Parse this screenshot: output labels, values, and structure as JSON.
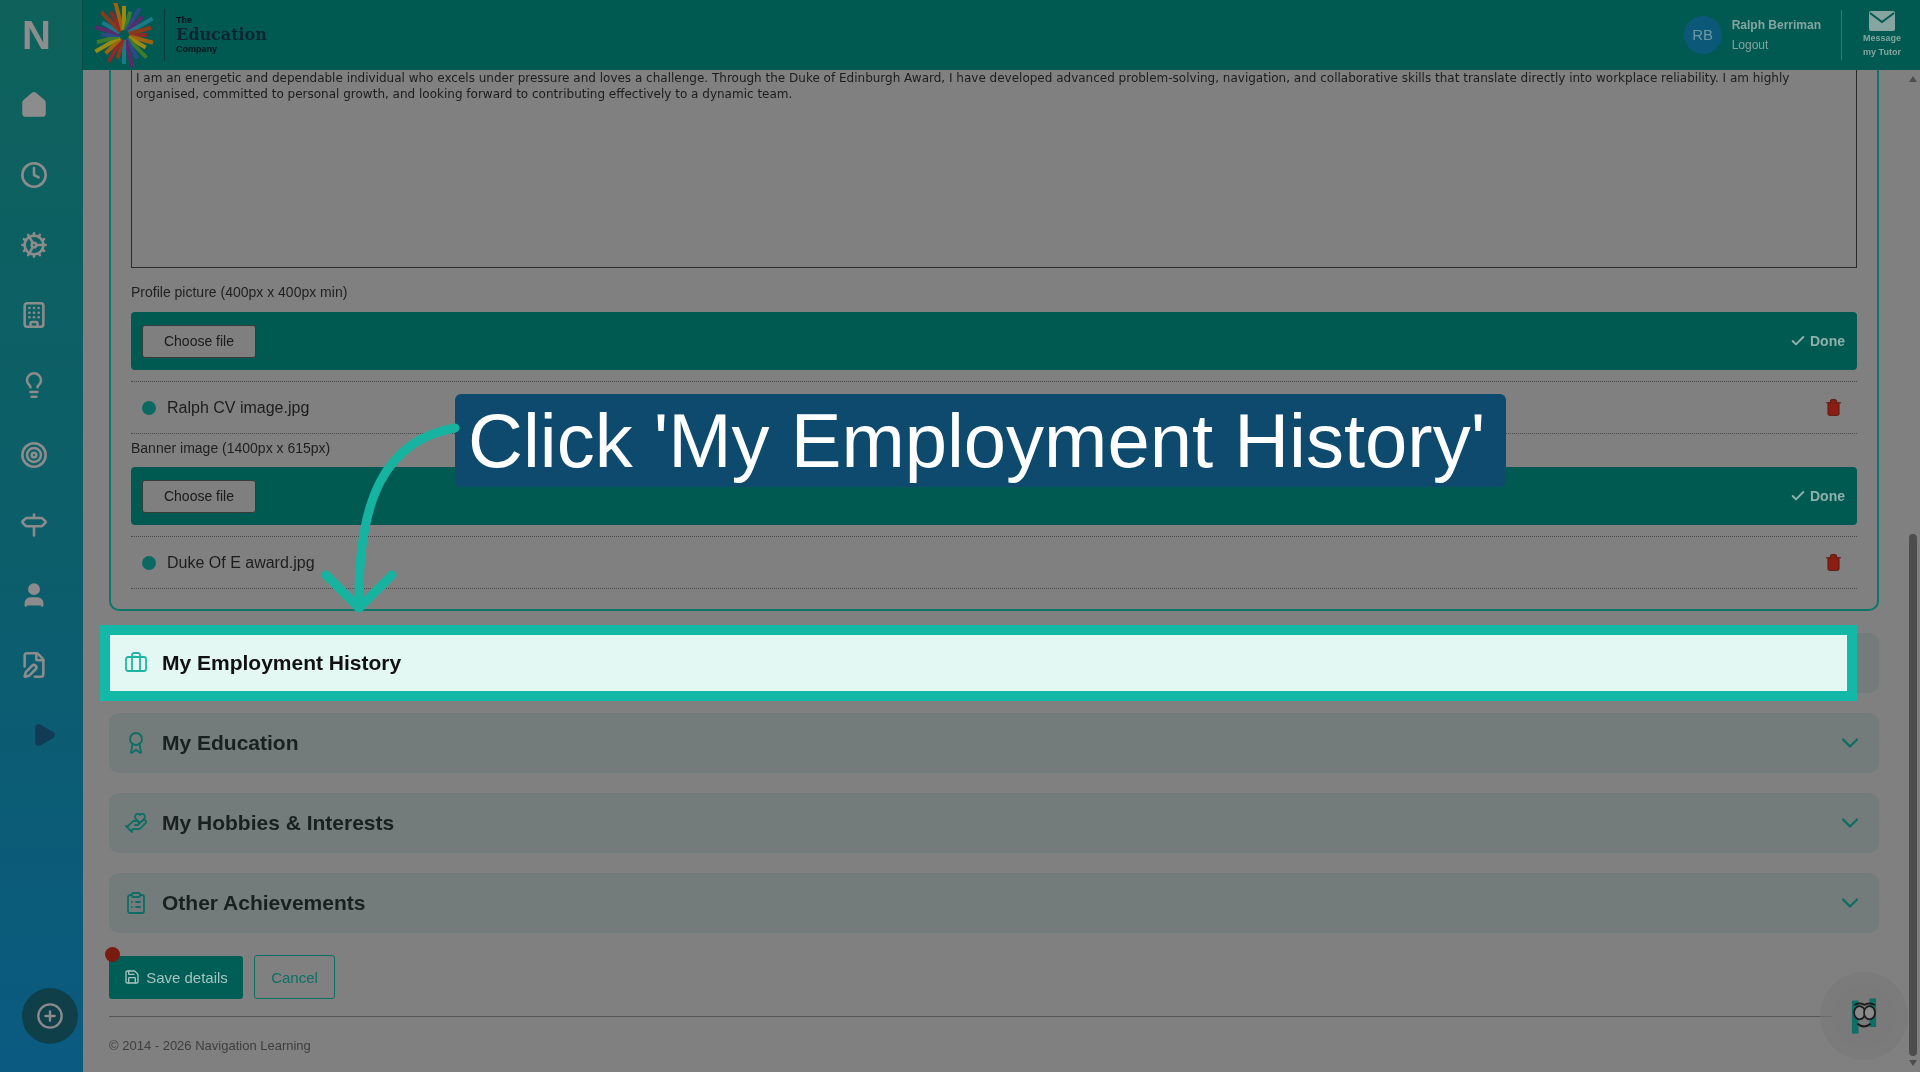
{
  "brand": {
    "mark": "N"
  },
  "header": {
    "logo": {
      "top": "The",
      "title": "Education",
      "bottom": "Company"
    },
    "user": {
      "initials": "RB",
      "name": "Ralph Berriman",
      "link": "Logout"
    },
    "message_button": {
      "label": "Message my Tutor"
    }
  },
  "form": {
    "about_text": "I am an energetic and dependable individual who excels under pressure and loves a challenge. Through the Duke of Edinburgh Award, I have developed advanced problem-solving, navigation, and collaborative skills that translate directly into workplace reliability. I am highly organised, committed to personal growth, and looking forward to contributing effectively to a dynamic team.",
    "uploads": [
      {
        "label": "Profile picture (400px x 400px min)",
        "button": "Choose file",
        "status": "Done",
        "file": "Ralph CV image.jpg"
      },
      {
        "label": "Banner image (1400px x 615px)",
        "button": "Choose file",
        "status": "Done",
        "file": "Duke Of E award.jpg"
      }
    ]
  },
  "sections": [
    {
      "title": "My Employment History",
      "highlighted": true
    },
    {
      "title": "My Education",
      "highlighted": false
    },
    {
      "title": "My Hobbies & Interests",
      "highlighted": false
    },
    {
      "title": "Other Achievements",
      "highlighted": false
    }
  ],
  "actions": {
    "save": "Save details",
    "cancel": "Cancel",
    "unsaved": true
  },
  "footer": {
    "copyright": "© 2014 - 2026 Navigation Learning"
  },
  "callout": {
    "text": "Click 'My Employment History'"
  }
}
